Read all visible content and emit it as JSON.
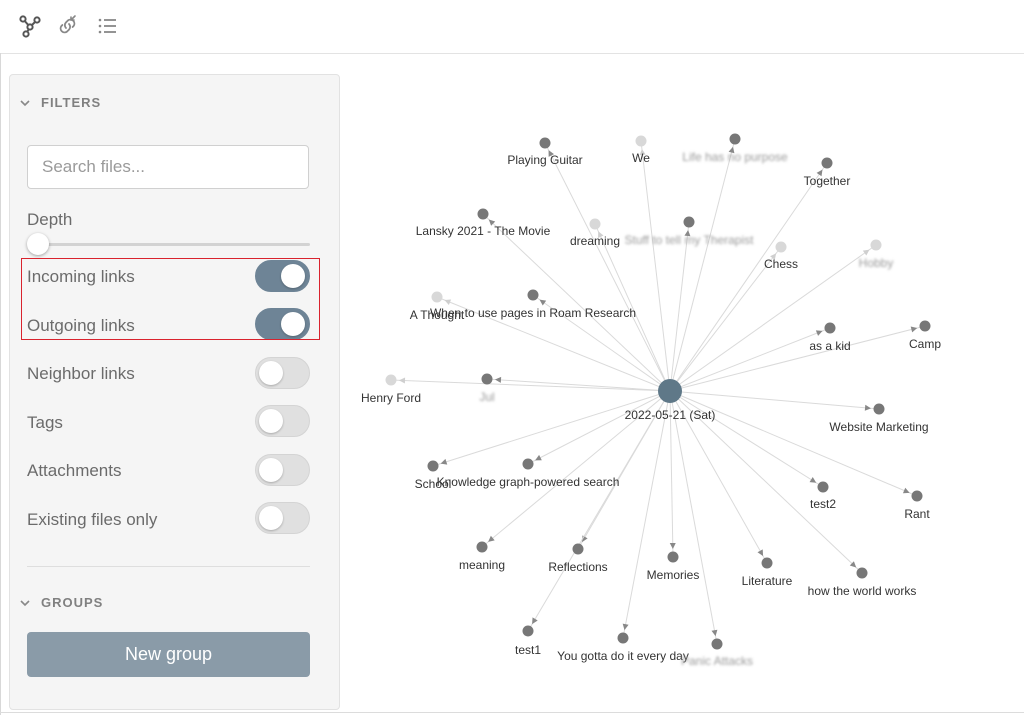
{
  "toolbar": {
    "icons": [
      "graph-view-icon",
      "linked-files-icon",
      "list-view-icon"
    ]
  },
  "filters": {
    "title": "FILTERS",
    "search_placeholder": "Search files...",
    "depth_label": "Depth",
    "depth_value": 0,
    "toggles": [
      {
        "key": "incoming",
        "label": "Incoming links",
        "on": true
      },
      {
        "key": "outgoing",
        "label": "Outgoing links",
        "on": true
      },
      {
        "key": "neighbor",
        "label": "Neighbor links",
        "on": false
      },
      {
        "key": "tags",
        "label": "Tags",
        "on": false
      },
      {
        "key": "attachments",
        "label": "Attachments",
        "on": false
      },
      {
        "key": "existing",
        "label": "Existing files only",
        "on": false
      }
    ]
  },
  "groups": {
    "title": "GROUPS",
    "new_group_label": "New group"
  },
  "colors": {
    "accent": "#6e8496",
    "button": "#8a9ba8",
    "node": "#777777",
    "node_faded": "#d8d8d8",
    "center_node": "#5f7888",
    "highlight": "#d9232e"
  },
  "graph": {
    "center": {
      "label": "2022-05-21 (Sat)"
    },
    "nodes": [
      {
        "label": "Playing Guitar",
        "faded": false,
        "blurred": false
      },
      {
        "label": "We",
        "faded": true,
        "blurred": false
      },
      {
        "label": "Life has no purpose",
        "faded": false,
        "blurred": true
      },
      {
        "label": "Together",
        "faded": false,
        "blurred": false
      },
      {
        "label": "Lansky 2021 - The Movie",
        "faded": false,
        "blurred": false
      },
      {
        "label": "dreaming",
        "faded": true,
        "blurred": false
      },
      {
        "label": "Stuff to tell my Therapist",
        "faded": false,
        "blurred": true
      },
      {
        "label": "Chess",
        "faded": true,
        "blurred": false
      },
      {
        "label": "Hobby",
        "faded": true,
        "blurred": true
      },
      {
        "label": "A Thought",
        "faded": true,
        "blurred": false
      },
      {
        "label": "When to use pages in Roam Research",
        "faded": false,
        "blurred": false
      },
      {
        "label": "as a kid",
        "faded": false,
        "blurred": false
      },
      {
        "label": "Camp",
        "faded": false,
        "blurred": false
      },
      {
        "label": "Henry Ford",
        "faded": true,
        "blurred": false
      },
      {
        "label": "Jul",
        "faded": false,
        "blurred": true
      },
      {
        "label": "Website Marketing",
        "faded": false,
        "blurred": false
      },
      {
        "label": "School",
        "faded": false,
        "blurred": false
      },
      {
        "label": "Knowledge graph-powered search",
        "faded": false,
        "blurred": false
      },
      {
        "label": "test2",
        "faded": false,
        "blurred": false
      },
      {
        "label": "Rant",
        "faded": false,
        "blurred": false
      },
      {
        "label": "meaning",
        "faded": false,
        "blurred": false
      },
      {
        "label": "Reflections",
        "faded": false,
        "blurred": false
      },
      {
        "label": "Memories",
        "faded": false,
        "blurred": false
      },
      {
        "label": "Literature",
        "faded": false,
        "blurred": false
      },
      {
        "label": "how the world works",
        "faded": false,
        "blurred": false
      },
      {
        "label": "test1",
        "faded": false,
        "blurred": false
      },
      {
        "label": "You gotta do it every day",
        "faded": false,
        "blurred": false
      },
      {
        "label": "Panic Attacks",
        "faded": false,
        "blurred": true
      }
    ]
  }
}
